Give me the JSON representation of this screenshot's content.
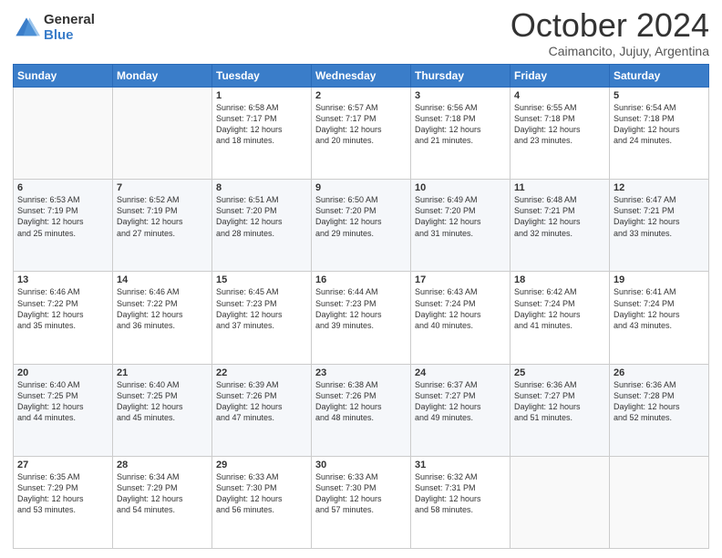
{
  "header": {
    "logo_general": "General",
    "logo_blue": "Blue",
    "month": "October 2024",
    "location": "Caimancito, Jujuy, Argentina"
  },
  "days_of_week": [
    "Sunday",
    "Monday",
    "Tuesday",
    "Wednesday",
    "Thursday",
    "Friday",
    "Saturday"
  ],
  "weeks": [
    [
      {
        "day": "",
        "info": ""
      },
      {
        "day": "",
        "info": ""
      },
      {
        "day": "1",
        "info": "Sunrise: 6:58 AM\nSunset: 7:17 PM\nDaylight: 12 hours\nand 18 minutes."
      },
      {
        "day": "2",
        "info": "Sunrise: 6:57 AM\nSunset: 7:17 PM\nDaylight: 12 hours\nand 20 minutes."
      },
      {
        "day": "3",
        "info": "Sunrise: 6:56 AM\nSunset: 7:18 PM\nDaylight: 12 hours\nand 21 minutes."
      },
      {
        "day": "4",
        "info": "Sunrise: 6:55 AM\nSunset: 7:18 PM\nDaylight: 12 hours\nand 23 minutes."
      },
      {
        "day": "5",
        "info": "Sunrise: 6:54 AM\nSunset: 7:18 PM\nDaylight: 12 hours\nand 24 minutes."
      }
    ],
    [
      {
        "day": "6",
        "info": "Sunrise: 6:53 AM\nSunset: 7:19 PM\nDaylight: 12 hours\nand 25 minutes."
      },
      {
        "day": "7",
        "info": "Sunrise: 6:52 AM\nSunset: 7:19 PM\nDaylight: 12 hours\nand 27 minutes."
      },
      {
        "day": "8",
        "info": "Sunrise: 6:51 AM\nSunset: 7:20 PM\nDaylight: 12 hours\nand 28 minutes."
      },
      {
        "day": "9",
        "info": "Sunrise: 6:50 AM\nSunset: 7:20 PM\nDaylight: 12 hours\nand 29 minutes."
      },
      {
        "day": "10",
        "info": "Sunrise: 6:49 AM\nSunset: 7:20 PM\nDaylight: 12 hours\nand 31 minutes."
      },
      {
        "day": "11",
        "info": "Sunrise: 6:48 AM\nSunset: 7:21 PM\nDaylight: 12 hours\nand 32 minutes."
      },
      {
        "day": "12",
        "info": "Sunrise: 6:47 AM\nSunset: 7:21 PM\nDaylight: 12 hours\nand 33 minutes."
      }
    ],
    [
      {
        "day": "13",
        "info": "Sunrise: 6:46 AM\nSunset: 7:22 PM\nDaylight: 12 hours\nand 35 minutes."
      },
      {
        "day": "14",
        "info": "Sunrise: 6:46 AM\nSunset: 7:22 PM\nDaylight: 12 hours\nand 36 minutes."
      },
      {
        "day": "15",
        "info": "Sunrise: 6:45 AM\nSunset: 7:23 PM\nDaylight: 12 hours\nand 37 minutes."
      },
      {
        "day": "16",
        "info": "Sunrise: 6:44 AM\nSunset: 7:23 PM\nDaylight: 12 hours\nand 39 minutes."
      },
      {
        "day": "17",
        "info": "Sunrise: 6:43 AM\nSunset: 7:24 PM\nDaylight: 12 hours\nand 40 minutes."
      },
      {
        "day": "18",
        "info": "Sunrise: 6:42 AM\nSunset: 7:24 PM\nDaylight: 12 hours\nand 41 minutes."
      },
      {
        "day": "19",
        "info": "Sunrise: 6:41 AM\nSunset: 7:24 PM\nDaylight: 12 hours\nand 43 minutes."
      }
    ],
    [
      {
        "day": "20",
        "info": "Sunrise: 6:40 AM\nSunset: 7:25 PM\nDaylight: 12 hours\nand 44 minutes."
      },
      {
        "day": "21",
        "info": "Sunrise: 6:40 AM\nSunset: 7:25 PM\nDaylight: 12 hours\nand 45 minutes."
      },
      {
        "day": "22",
        "info": "Sunrise: 6:39 AM\nSunset: 7:26 PM\nDaylight: 12 hours\nand 47 minutes."
      },
      {
        "day": "23",
        "info": "Sunrise: 6:38 AM\nSunset: 7:26 PM\nDaylight: 12 hours\nand 48 minutes."
      },
      {
        "day": "24",
        "info": "Sunrise: 6:37 AM\nSunset: 7:27 PM\nDaylight: 12 hours\nand 49 minutes."
      },
      {
        "day": "25",
        "info": "Sunrise: 6:36 AM\nSunset: 7:27 PM\nDaylight: 12 hours\nand 51 minutes."
      },
      {
        "day": "26",
        "info": "Sunrise: 6:36 AM\nSunset: 7:28 PM\nDaylight: 12 hours\nand 52 minutes."
      }
    ],
    [
      {
        "day": "27",
        "info": "Sunrise: 6:35 AM\nSunset: 7:29 PM\nDaylight: 12 hours\nand 53 minutes."
      },
      {
        "day": "28",
        "info": "Sunrise: 6:34 AM\nSunset: 7:29 PM\nDaylight: 12 hours\nand 54 minutes."
      },
      {
        "day": "29",
        "info": "Sunrise: 6:33 AM\nSunset: 7:30 PM\nDaylight: 12 hours\nand 56 minutes."
      },
      {
        "day": "30",
        "info": "Sunrise: 6:33 AM\nSunset: 7:30 PM\nDaylight: 12 hours\nand 57 minutes."
      },
      {
        "day": "31",
        "info": "Sunrise: 6:32 AM\nSunset: 7:31 PM\nDaylight: 12 hours\nand 58 minutes."
      },
      {
        "day": "",
        "info": ""
      },
      {
        "day": "",
        "info": ""
      }
    ]
  ]
}
